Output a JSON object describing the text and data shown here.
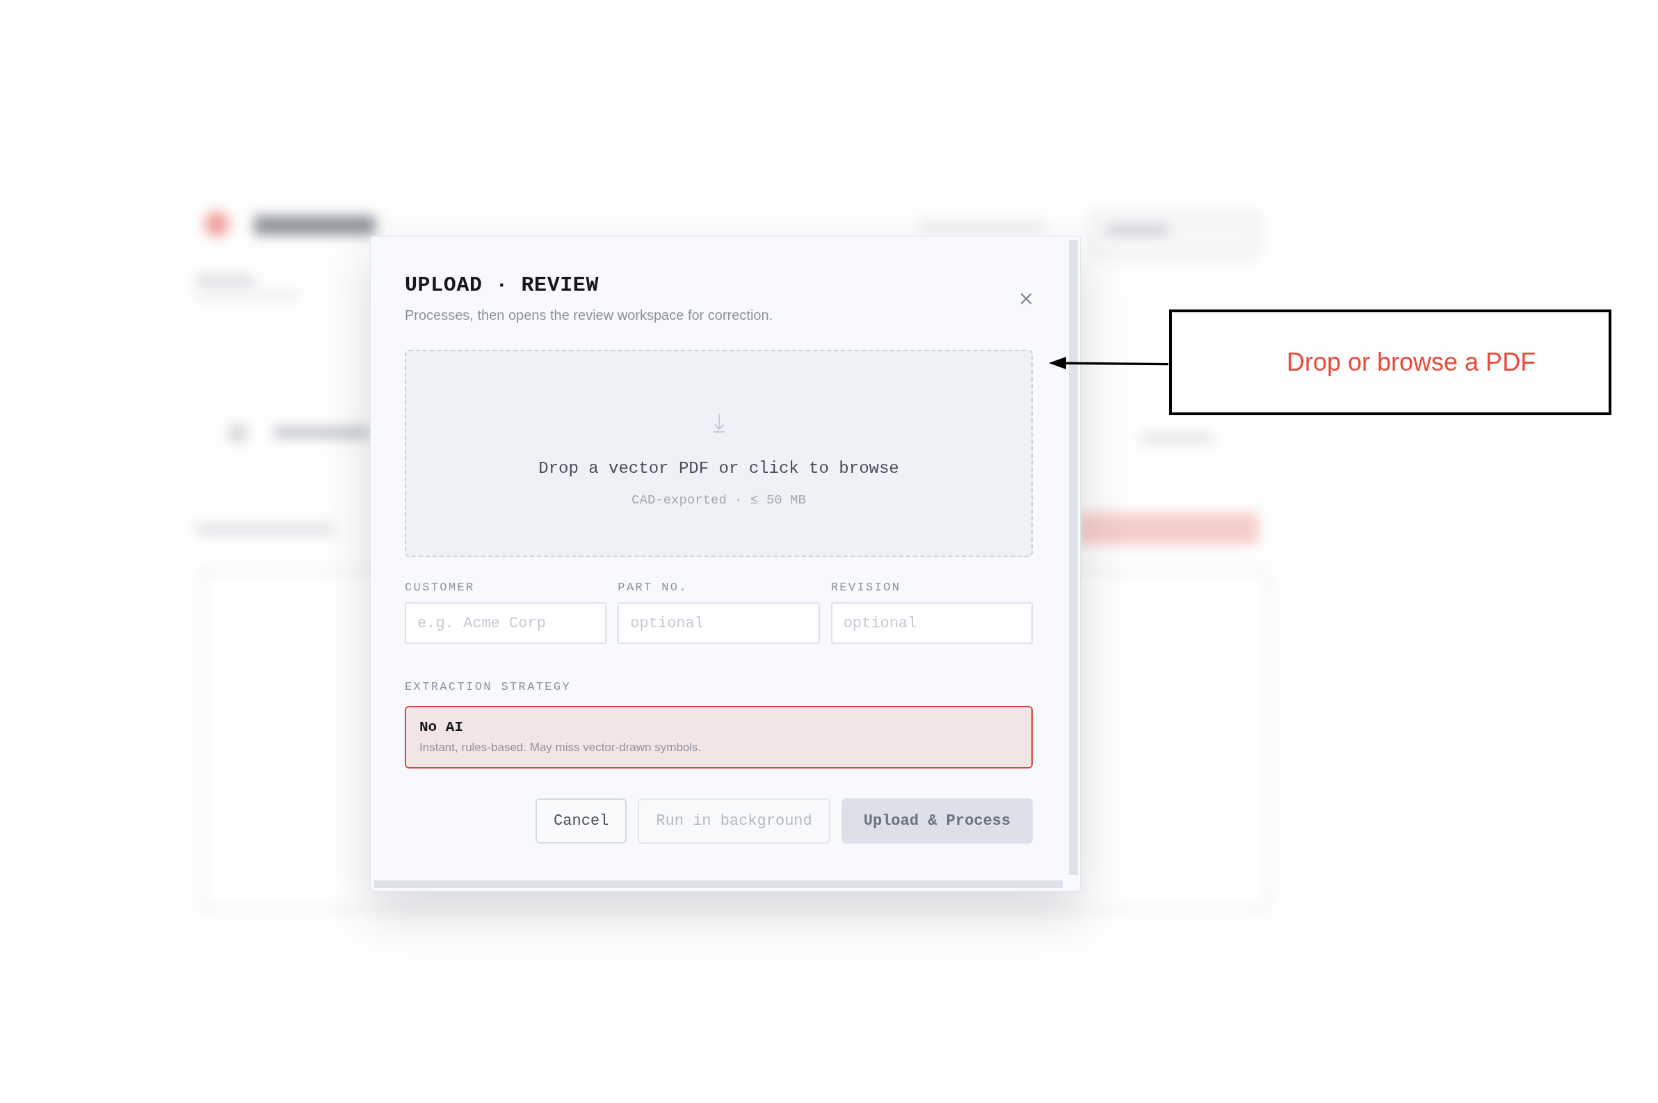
{
  "dialog": {
    "title": "UPLOAD · REVIEW",
    "subtitle": "Processes, then opens the review workspace for correction.",
    "dropzone": {
      "prompt": "Drop a vector PDF or click to browse",
      "hint": "CAD-exported · ≤ 50 MB"
    },
    "fields": [
      {
        "label": "CUSTOMER",
        "placeholder": "e.g. Acme Corp"
      },
      {
        "label": "PART NO.",
        "placeholder": "optional"
      },
      {
        "label": "REVISION",
        "placeholder": "optional"
      }
    ],
    "strategy": {
      "label": "EXTRACTION STRATEGY",
      "options": [
        {
          "name": "No AI",
          "description": "Instant, rules-based. May miss vector-drawn symbols.",
          "selected": true
        }
      ]
    },
    "buttons": [
      {
        "label": "Cancel",
        "kind": "secondary",
        "disabled": false
      },
      {
        "label": "Run in background",
        "kind": "secondary",
        "disabled": true
      },
      {
        "label": "Upload & Process",
        "kind": "primary",
        "disabled": true
      }
    ]
  },
  "annotation": {
    "text": "Drop or browse a PDF"
  }
}
